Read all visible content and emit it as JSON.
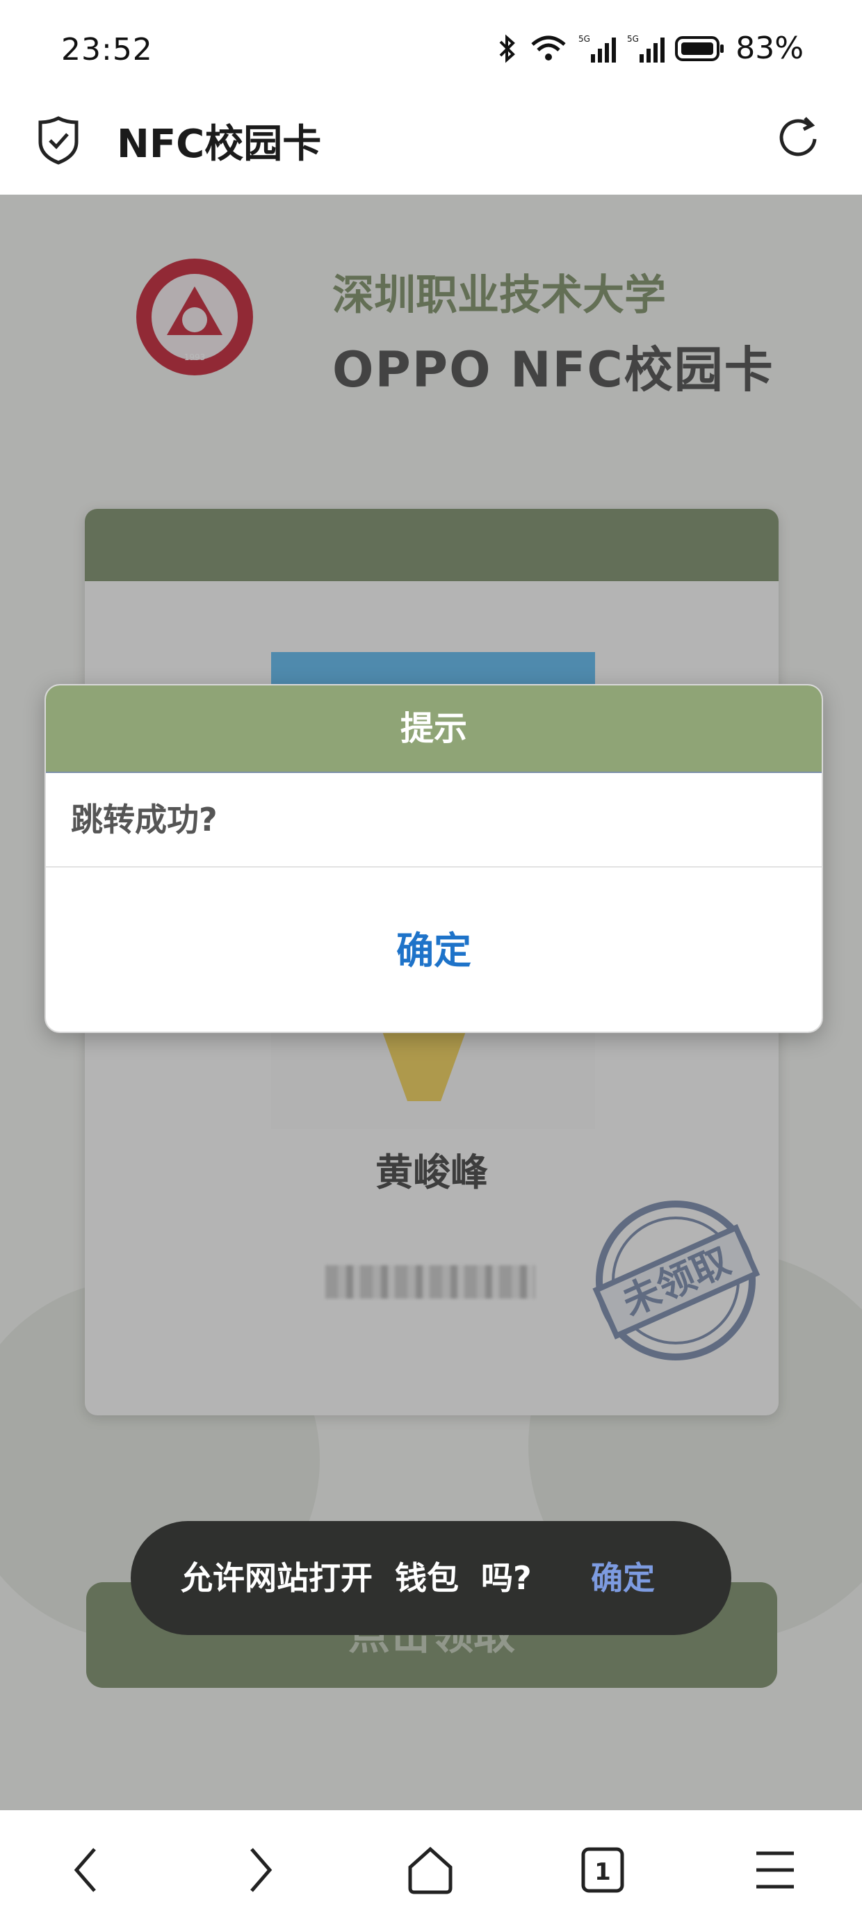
{
  "status_bar": {
    "time": "23:52",
    "battery": "83%",
    "network": "5G"
  },
  "app_bar": {
    "title": "NFC校园卡"
  },
  "page": {
    "school_name": "深圳职业技术大学",
    "card_title": "OPPO NFC校园卡",
    "logo_year": "1993",
    "holder_name": "黄峻峰",
    "stamp_text": "未领取",
    "claim_button": "点击领取"
  },
  "dialog": {
    "title": "提示",
    "message": "跳转成功?",
    "confirm": "确定"
  },
  "toast": {
    "text": "允许网站打开  钱包  吗?",
    "action": "确定"
  },
  "bottom_nav": {
    "tab_count": "1"
  },
  "colors": {
    "accent_green": "#8fa476",
    "link_blue": "#1e73c9",
    "toast_bg": "#2f302e"
  }
}
